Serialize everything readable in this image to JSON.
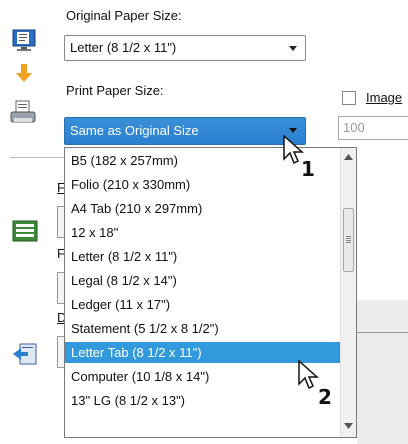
{
  "original_label": "Original Paper Size:",
  "original_value": "Letter (8 1/2 x 11\")",
  "print_label": "Print Paper Size:",
  "print_value": "Same as Original Size",
  "image_label": "Image",
  "zoom_value": "100",
  "obscured_label_1": "F",
  "obscured_label_2": "F",
  "obscured_label_3": "D",
  "options": [
    "B5 (182 x 257mm)",
    "Folio (210 x 330mm)",
    "A4 Tab (210 x 297mm)",
    "12 x 18\"",
    "Letter (8 1/2 x 11\")",
    "Legal (8 1/2 x 14\")",
    "Ledger (11 x 17\")",
    "Statement (5 1/2 x 8 1/2\")",
    "Letter Tab (8 1/2 x 11\")",
    "Computer (10 1/8 x 14\")",
    "13\" LG (8 1/2 x 13\")"
  ],
  "highlighted_option": "Letter Tab (8 1/2 x 11\")",
  "callout_1": "1",
  "callout_2": "2",
  "icons": [
    "document-monitor-icon",
    "arrow-down-icon",
    "printer-icon",
    "stack-icon",
    "import-icon"
  ],
  "colors": {
    "highlight": "#3399dd",
    "selected_combo": "#2a7fcf",
    "arrow": "#f0a020"
  }
}
